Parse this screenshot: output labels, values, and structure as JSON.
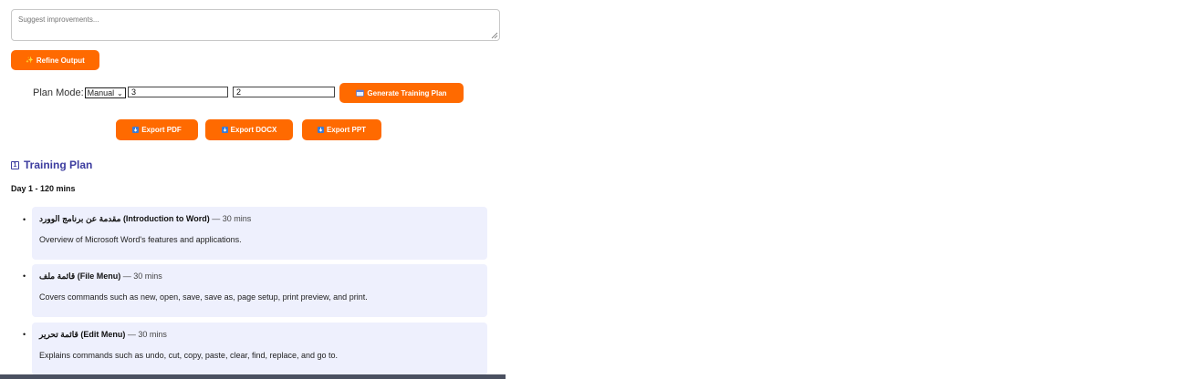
{
  "suggest": {
    "placeholder": "Suggest improvements..."
  },
  "refine": {
    "label": "Refine Output",
    "icon": "sparkles-icon"
  },
  "plan": {
    "label": "Plan Mode:",
    "mode_selected": "Manual",
    "days_value": "3",
    "hours_value": "2",
    "generate_label": "Generate Training Plan",
    "generate_icon": "calendar-icon"
  },
  "export": {
    "pdf_label": "Export PDF",
    "docx_label": "Export DOCX",
    "ppt_label": "Export PPT",
    "icon": "download-icon"
  },
  "training_plan": {
    "title": "Training Plan",
    "title_icon": "1",
    "day_heading": "Day 1 - 120 mins",
    "topics": [
      {
        "arabic": "مقدمة عن برنامج الوورد",
        "english": "(Introduction to Word)",
        "duration": "— 30 mins",
        "description": "Overview of Microsoft Word's features and applications."
      },
      {
        "arabic": "قائمة ملف",
        "english": "(File Menu)",
        "duration": "— 30 mins",
        "description": "Covers commands such as new, open, save, save as, page setup, print preview, and print."
      },
      {
        "arabic": "قائمة تحرير",
        "english": "(Edit Menu)",
        "duration": "— 30 mins",
        "description": "Explains commands such as undo, cut, copy, paste, clear, find, replace, and go to."
      }
    ]
  },
  "colors": {
    "accent": "#ff6a00",
    "title": "#3c3c9f",
    "card_bg": "#eef0fd"
  }
}
